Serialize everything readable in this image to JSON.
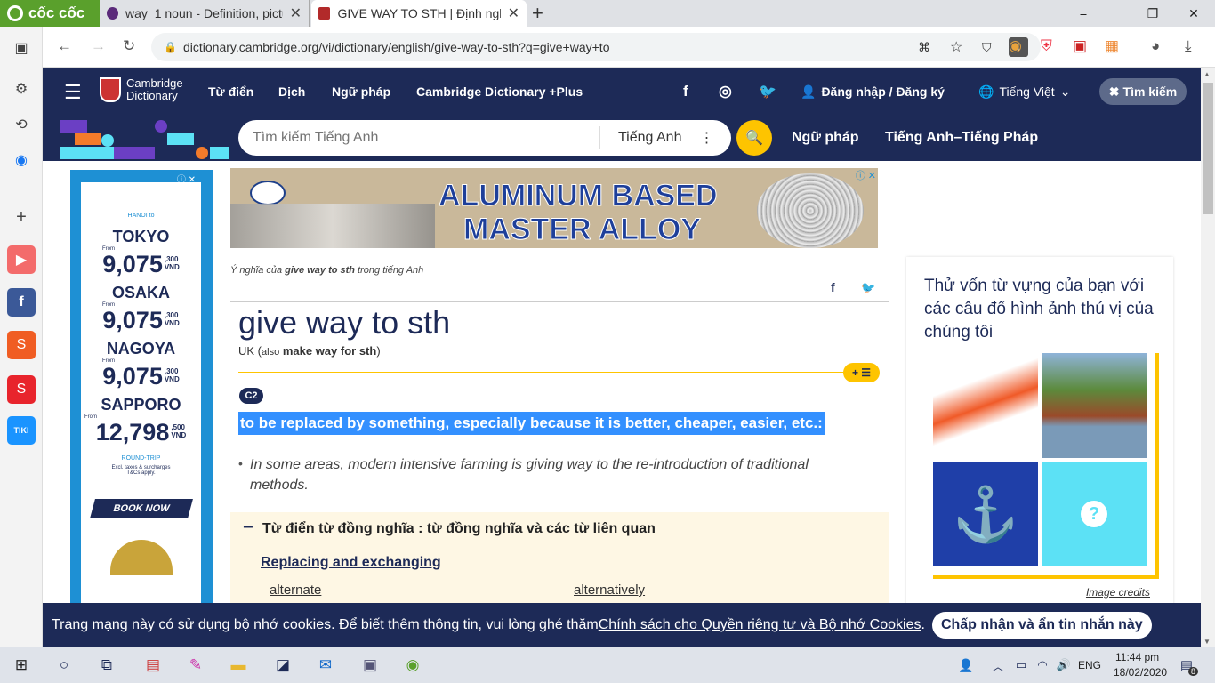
{
  "browser": {
    "brand": "cốc cốc",
    "tabs": [
      {
        "title": "way_1 noun - Definition, pictu",
        "close": "✕"
      },
      {
        "title": "GIVE WAY TO STH | Định nghĩ",
        "close": "✕"
      }
    ],
    "new_tab": "+",
    "url": "dictionary.cambridge.org/vi/dictionary/english/give-way-to-sth?q=give+way+to",
    "window_controls": [
      "⎯",
      "❐",
      "✕"
    ]
  },
  "site": {
    "logo_line1": "Cambridge",
    "logo_line2": "Dictionary",
    "nav": [
      "Từ điển",
      "Dịch",
      "Ngữ pháp",
      "Cambridge Dictionary +Plus"
    ],
    "login": "Đăng nhập / Đăng ký",
    "language": "Tiếng Việt",
    "search_button": "Tìm kiếm",
    "search_placeholder": "Tìm kiếm Tiếng Anh",
    "search_lang": "Tiếng Anh",
    "sub_nav": [
      "Ngữ pháp",
      "Tiếng Anh–Tiếng Pháp"
    ]
  },
  "left_ad": {
    "header": "HANOI to",
    "cities": [
      {
        "name": "TOKYO",
        "from": "From",
        "price": "9,075",
        "small": ",300",
        "cur": "VND"
      },
      {
        "name": "OSAKA",
        "from": "From",
        "price": "9,075",
        "small": ",300",
        "cur": "VND"
      },
      {
        "name": "NAGOYA",
        "from": "From",
        "price": "9,075",
        "small": ",300",
        "cur": "VND"
      },
      {
        "name": "SAPPORO",
        "from": "From",
        "price": "12,798",
        "small": ",500",
        "cur": "VND"
      }
    ],
    "roundtrip": "ROUND-TRIP",
    "note1": "Excl. taxes & surcharges",
    "note2": "T&Cs apply.",
    "cta": "BOOK NOW"
  },
  "top_ad": {
    "line1": "ALUMINUM BASED",
    "line2": "MASTER ALLOY"
  },
  "entry": {
    "meaning_pre": "Ý nghĩa của ",
    "meaning_word": "give way to sth",
    "meaning_post": " trong tiếng Anh",
    "headword": "give way to sth",
    "region": "UK",
    "also_open": " (",
    "also": "also",
    "also_word": "make way for sth",
    "also_close": ")",
    "level": "C2",
    "definition": "to be replaced by something, especially because it is better, cheaper, easier, etc.:",
    "example": "In some areas, modern intensive farming is giving way to the re-introduction of traditional methods.",
    "thesaurus_title": "Từ điển từ đồng nghĩa : từ đồng nghĩa và các từ liên quan",
    "thesaurus_heading": "Replacing and exchanging",
    "related": [
      "alternate",
      "alternatively"
    ]
  },
  "quiz": {
    "title": "Thử vốn từ vựng của bạn với các câu đố hình ảnh thú vị của chúng tôi",
    "credits": "Image credits"
  },
  "cookie": {
    "text": "Trang mạng này có sử dụng bộ nhớ cookies. Để biết thêm thông tin, vui lòng ghé thăm ",
    "link": "Chính sách cho Quyền riêng tư và Bộ nhớ Cookies",
    "end": ".",
    "button": "Chấp nhận và ẩn tin nhắn này"
  },
  "taskbar": {
    "lang": "ENG",
    "time": "11:44 pm",
    "date": "18/02/2020",
    "notif": "8"
  },
  "colors": {
    "navy": "#1d2a57",
    "yellow": "#fec400",
    "highlight": "#3390ff"
  }
}
